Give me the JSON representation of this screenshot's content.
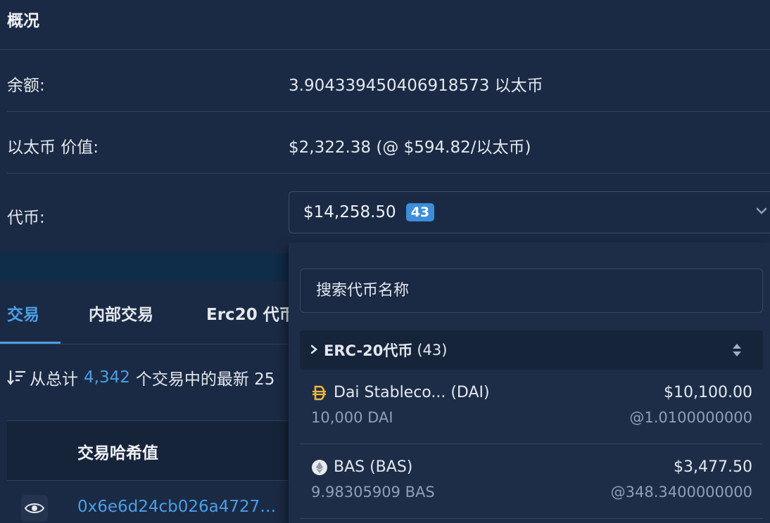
{
  "overview": {
    "title": "概况",
    "balance_label": "余额:",
    "balance_value": "3.904339450406918573 以太币",
    "eth_value_label": "以太币 价值:",
    "eth_value": "$2,322.38 (@ $594.82/以太币)",
    "tokens_label": "代币:",
    "tokens_total": "$14,258.50",
    "tokens_count": "43"
  },
  "tabs": [
    {
      "label": "交易"
    },
    {
      "label": "内部交易"
    },
    {
      "label": "Erc20 代币"
    }
  ],
  "summary": {
    "prefix": "从总计",
    "count": "4,342",
    "suffix": "个交易中的最新 25"
  },
  "table": {
    "header_hash": "交易哈希值",
    "first_hash": "0x6e6d24cb026a4727…"
  },
  "dropdown": {
    "search_placeholder": "搜索代币名称",
    "group_title": "ERC-20代币",
    "group_count": "(43)",
    "tokens": [
      {
        "name": "Dai Stableco... (DAI)",
        "value": "$10,100.00",
        "qty": "10,000 DAI",
        "rate": "@1.0100000000",
        "icon": "dai-icon"
      },
      {
        "name": "BAS (BAS)",
        "value": "$3,477.50",
        "qty": "9.98305909 BAS",
        "rate": "@348.3400000000",
        "icon": "eth-token-icon"
      }
    ]
  },
  "colors": {
    "background": "#1b2a44",
    "accent": "#4a9fe6",
    "badge": "#3b8ed8",
    "muted": "#8e9fb8"
  }
}
